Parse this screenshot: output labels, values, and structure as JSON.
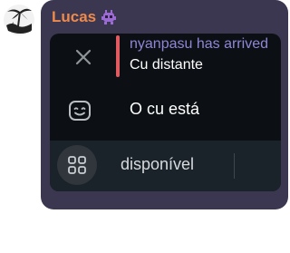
{
  "message": {
    "sender_name": "Lucas",
    "sender_icon": "alien-emoji-icon",
    "sender_color": "#ee8a4b",
    "avatar_icon": "palm-tree-avatar"
  },
  "reply": {
    "author": "nyanpasu has arrived",
    "text": "Cu distante",
    "author_color": "#8f86d7",
    "bar_color": "#e05a5f",
    "close_icon": "close-icon"
  },
  "content": {
    "emoji_icon": "emoji-icon",
    "emoji_text": "O cu está"
  },
  "composer": {
    "apps_icon": "apps-grid-icon",
    "text": "disponível"
  },
  "colors": {
    "bubble": "#3b3750",
    "card": "#0c1014",
    "input": "#1a2329"
  }
}
